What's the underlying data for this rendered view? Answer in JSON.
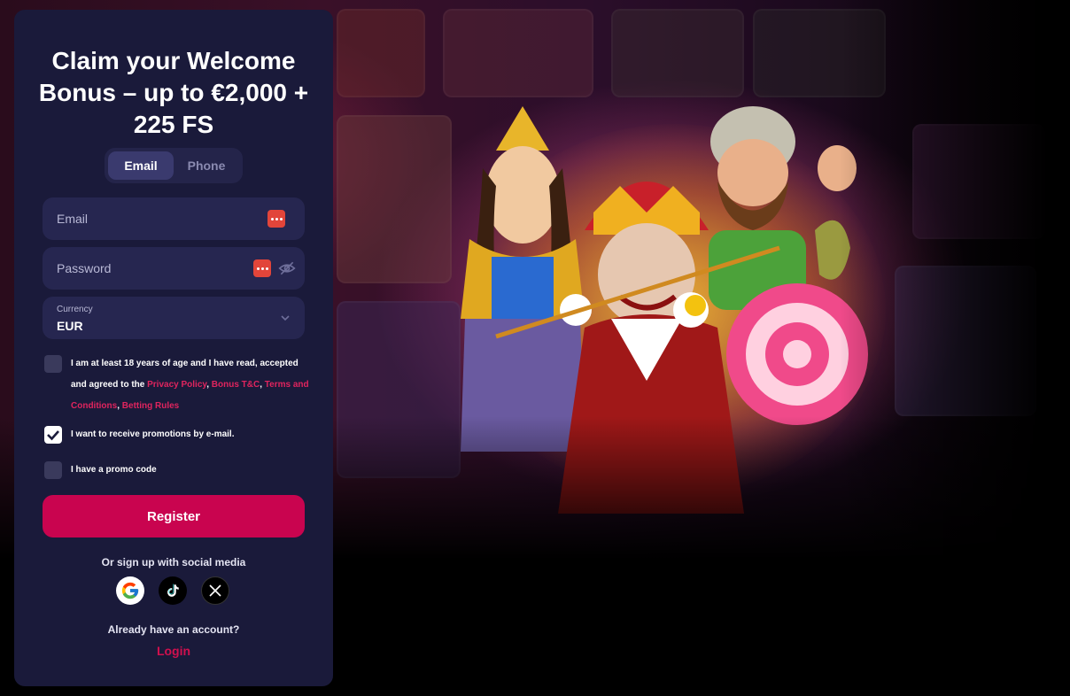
{
  "title": "Claim your Welcome Bonus – up to €2,000 + 225 FS",
  "tabs": [
    {
      "label": "Email",
      "active": true
    },
    {
      "label": "Phone",
      "active": false
    }
  ],
  "form": {
    "email_placeholder": "Email",
    "password_placeholder": "Password",
    "currency_label": "Currency",
    "currency_value": "EUR"
  },
  "checks": {
    "age": {
      "text_before": "I am at least 18 years of age and I have read, accepted and agreed to the ",
      "privacy": "Privacy Policy",
      "bonus": "Bonus T&C",
      "terms": "Terms and Conditions",
      "betting": "Betting Rules",
      "checked": false
    },
    "promo_email": {
      "text": "I want to receive promotions by e-mail.",
      "checked": true
    },
    "promo_code": {
      "text": "I have a promo code",
      "checked": false
    }
  },
  "register_label": "Register",
  "social_title": "Or sign up with social media",
  "social": [
    "google-icon",
    "tiktok-icon",
    "x-icon"
  ],
  "account_text": "Already have an account?",
  "login_label": "Login",
  "colors": {
    "panel": "#1a1a3a",
    "field": "#262650",
    "accent": "#c9044f",
    "link": "#e0245e"
  }
}
